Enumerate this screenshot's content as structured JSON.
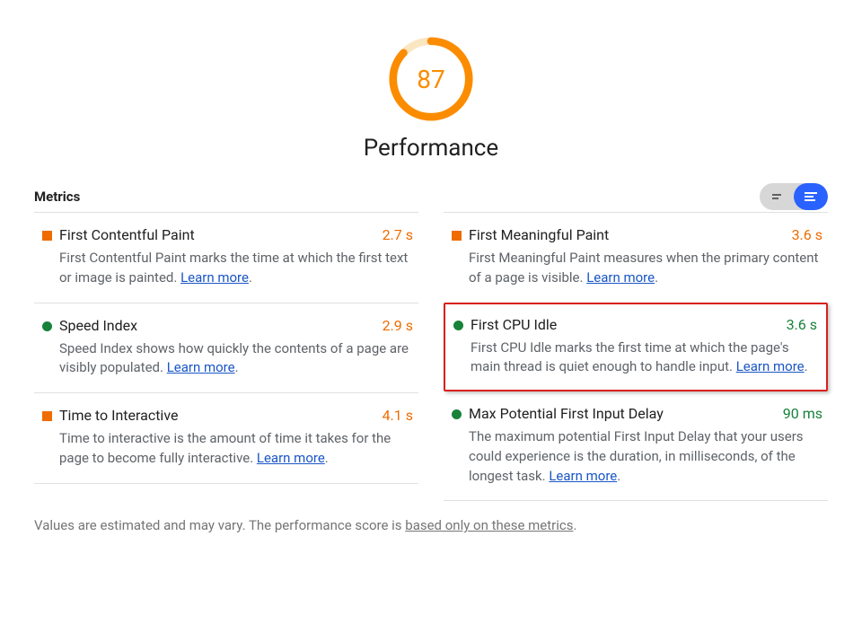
{
  "score": "87",
  "category": "Performance",
  "metrics_heading": "Metrics",
  "learn_more": "Learn more",
  "metrics_left": [
    {
      "status": "avg",
      "title": "First Contentful Paint",
      "value": "2.7 s",
      "desc": "First Contentful Paint marks the time at which the first text or image is painted."
    },
    {
      "status": "pass",
      "title": "Speed Index",
      "value": "2.9 s",
      "desc": "Speed Index shows how quickly the contents of a page are visibly populated."
    },
    {
      "status": "avg",
      "title": "Time to Interactive",
      "value": "4.1 s",
      "desc": "Time to interactive is the amount of time it takes for the page to become fully interactive."
    }
  ],
  "metrics_right": [
    {
      "status": "avg",
      "title": "First Meaningful Paint",
      "value": "3.6 s",
      "desc": "First Meaningful Paint measures when the primary content of a page is visible."
    },
    {
      "status": "pass",
      "title": "First CPU Idle",
      "value": "3.6 s",
      "desc": "First CPU Idle marks the first time at which the page's main thread is quiet enough to handle input."
    },
    {
      "status": "pass",
      "title": "Max Potential First Input Delay",
      "value": "90 ms",
      "desc": "The maximum potential First Input Delay that your users could experience is the duration, in milliseconds, of the longest task."
    }
  ],
  "footnote_prefix": "Values are estimated and may vary. The performance score is ",
  "footnote_link": "based only on these metrics",
  "footnote_suffix": "."
}
